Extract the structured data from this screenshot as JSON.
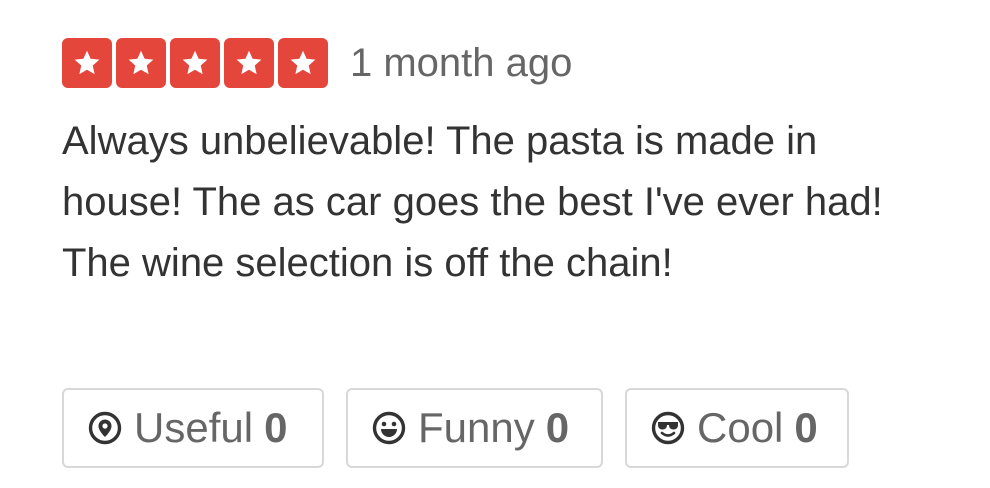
{
  "review": {
    "rating": 5,
    "rating_max": 5,
    "star_color": "#e5463b",
    "time_ago": "1 month ago",
    "text": "Always unbelievable! The pasta is made in house! The as car goes the best I've ever had! The wine selection is off the chain!"
  },
  "actions": [
    {
      "icon": "useful-icon",
      "label": "Useful",
      "count": "0"
    },
    {
      "icon": "funny-icon",
      "label": "Funny",
      "count": "0"
    },
    {
      "icon": "cool-icon",
      "label": "Cool",
      "count": "0"
    }
  ]
}
